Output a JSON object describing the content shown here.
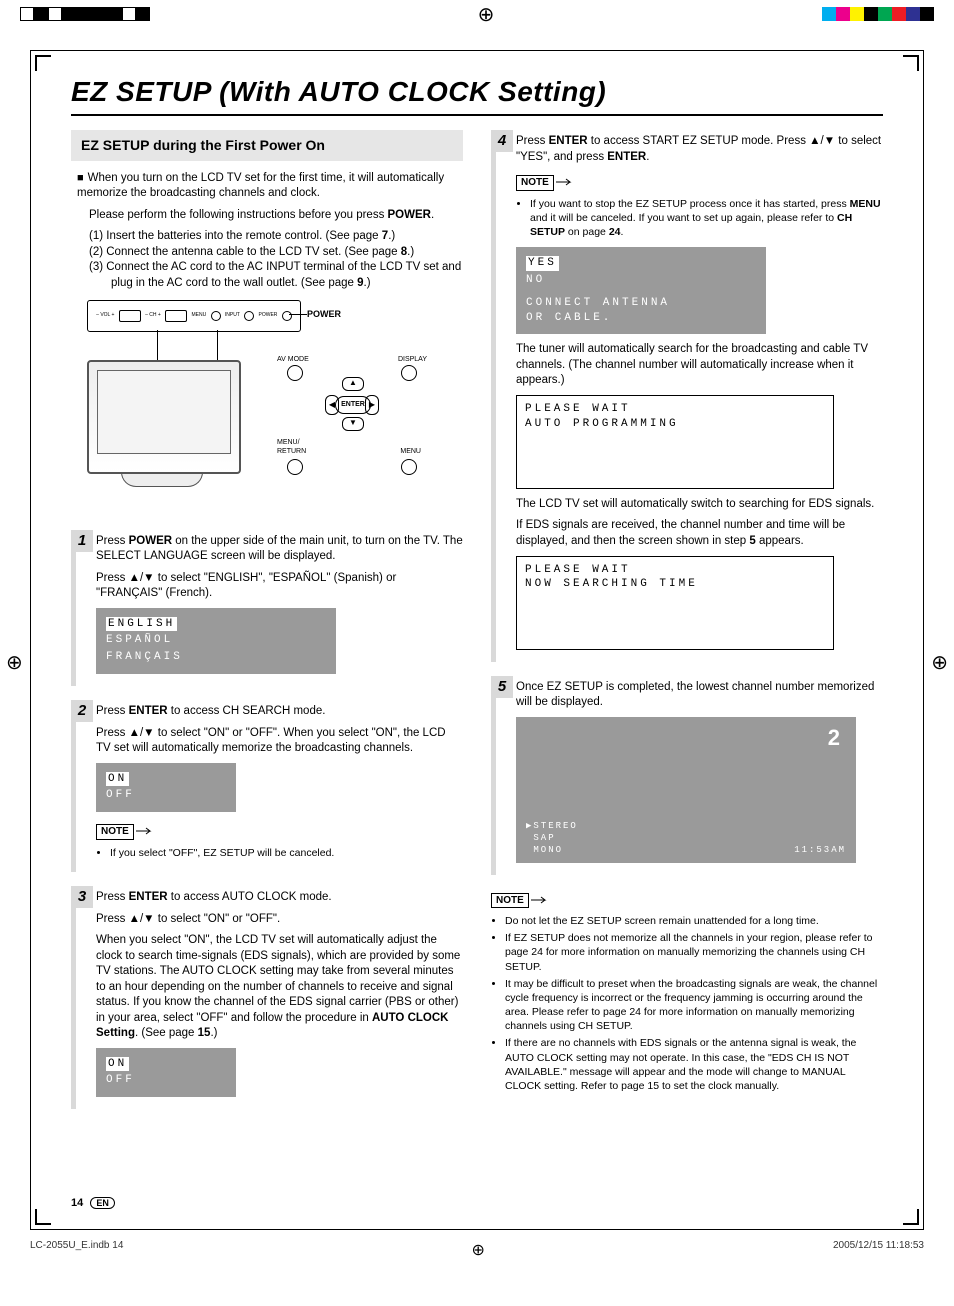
{
  "page": {
    "title": "EZ SETUP (With AUTO CLOCK Setting)",
    "number": "14",
    "lang_badge": "EN",
    "slug_file": "LC-2055U_E.indb   14",
    "slug_date": "2005/12/15   11:18:53"
  },
  "left": {
    "subhead": "EZ SETUP during the First Power On",
    "intro1": "When you turn on the LCD TV set for the first time, it will automatically memorize the broadcasting channels and clock.",
    "intro2_a": "Please perform the following instructions before you press ",
    "intro2_b": "POWER",
    "intro2_c": ".",
    "sub1_a": "(1) Insert the batteries into the remote control. (See page ",
    "sub1_b": "7",
    "sub1_c": ".)",
    "sub2_a": "(2) Connect the antenna cable to the LCD TV set. (See page ",
    "sub2_b": "8",
    "sub2_c": ".)",
    "sub3_a": "(3) Connect the AC cord to the AC INPUT terminal of the LCD TV set and plug in the AC cord to the wall outlet. (See page ",
    "sub3_b": "9",
    "sub3_c": ".)",
    "illus": {
      "power_label": "POWER",
      "panel_labels": [
        "– VOL +",
        "– CH +",
        "MENU",
        "INPUT",
        "POWER"
      ],
      "remote_labels": {
        "avmode": "AV MODE",
        "display": "DISPLAY",
        "menureturn": "MENU/\nRETURN",
        "menu": "MENU",
        "enter": "ENTER"
      }
    },
    "step1_a": "Press ",
    "step1_b": "POWER",
    "step1_c": " on the upper side of the main unit, to turn on the TV. The SELECT LANGUAGE screen will be displayed.",
    "step1_d1": "Press ",
    "step1_d2": "▲/▼",
    "step1_d3": " to select \"ENGLISH\", \"ESPAÑOL\" (Spanish) or \"FRANÇAIS\" (French).",
    "osd_lang": [
      "ENGLISH",
      "ESPAÑOL",
      "FRANÇAIS"
    ],
    "step2_a": "Press ",
    "step2_b": "ENTER",
    "step2_c": " to access CH SEARCH mode.",
    "step2_d1": "Press ",
    "step2_d2": "▲/▼",
    "step2_d3": " to select \"ON\" or \"OFF\". When you select \"ON\", the LCD TV set will automatically memorize the broadcasting channels.",
    "osd_onoff": [
      "ON",
      "OFF"
    ],
    "note2": "If you select \"OFF\", EZ SETUP will be canceled.",
    "step3_a": "Press ",
    "step3_b": "ENTER",
    "step3_c": " to access AUTO CLOCK mode.",
    "step3_d1": "Press ",
    "step3_d2": "▲/▼",
    "step3_d3": " to select \"ON\" or \"OFF\".",
    "step3_e1": "When you select \"ON\", the LCD TV set will automatically adjust the clock to search time-signals (EDS signals), which are provided by some TV stations. The AUTO CLOCK setting may take from several minutes to an hour depending on the number of channels to receive and signal status. If you know the channel of the EDS signal carrier (PBS or other) in your area, select \"OFF\" and follow the procedure in ",
    "step3_e2": "AUTO CLOCK Setting",
    "step3_e3": ". (See page ",
    "step3_e4": "15",
    "step3_e5": ".)"
  },
  "right": {
    "step4_a": "Press ",
    "step4_b": "ENTER",
    "step4_c": " to access START EZ SETUP mode. Press ",
    "step4_d": "▲/▼",
    "step4_e": " to select \"YES\", and press ",
    "step4_f": "ENTER",
    "step4_g": ".",
    "note4_a": "If you want to stop the EZ SETUP process once it has started, press ",
    "note4_b": "MENU",
    "note4_c": " and it will be canceled. If you want to set up again, please refer to ",
    "note4_d": "CH SETUP",
    "note4_e": " on page ",
    "note4_f": "24",
    "note4_g": ".",
    "osd_yesno": {
      "yes": "YES",
      "no": "NO",
      "msg": "CONNECT ANTENNA\nOR CABLE."
    },
    "tuner_text": "The tuner will automatically search for the broadcasting and cable TV channels. (The channel number will automatically increase when it appears.)",
    "osd_wait1": [
      "PLEASE WAIT",
      "AUTO PROGRAMMING"
    ],
    "eds1": "The LCD TV set will automatically switch to searching for EDS signals.",
    "eds2_a": "If EDS signals are received, the channel number and time will be displayed, and then the screen shown in step ",
    "eds2_b": "5",
    "eds2_c": " appears.",
    "osd_wait2": [
      "PLEASE WAIT",
      "NOW SEARCHING TIME"
    ],
    "step5_text": "Once EZ SETUP is completed, the lowest channel number memorized will be displayed.",
    "osd_channel": {
      "ch": "2",
      "bl": "▶STEREO\n SAP\n MONO",
      "br": "11:53AM"
    },
    "final_notes": [
      "Do not let the EZ SETUP screen remain unattended for a long time.",
      "If EZ SETUP does not memorize all the channels in your region, please refer to page 24 for more information on manually memorizing the channels using CH SETUP.",
      "It may be difficult to preset when the broadcasting signals are weak, the channel cycle frequency is incorrect or the frequency jamming is occurring around the area.  Please refer to page 24 for more information on manually memorizing channels using CH SETUP.",
      "If there are no channels with EDS signals or the antenna signal is weak, the AUTO CLOCK setting may not operate. In this case, the \"EDS CH IS NOT AVAILABLE.\" message will appear and the mode will change to MANUAL CLOCK setting. Refer to page 15 to set the clock manually."
    ],
    "final_notes_pages": {
      "1": "24",
      "2": "24",
      "3": "15"
    }
  },
  "labels": {
    "note": "NOTE"
  }
}
